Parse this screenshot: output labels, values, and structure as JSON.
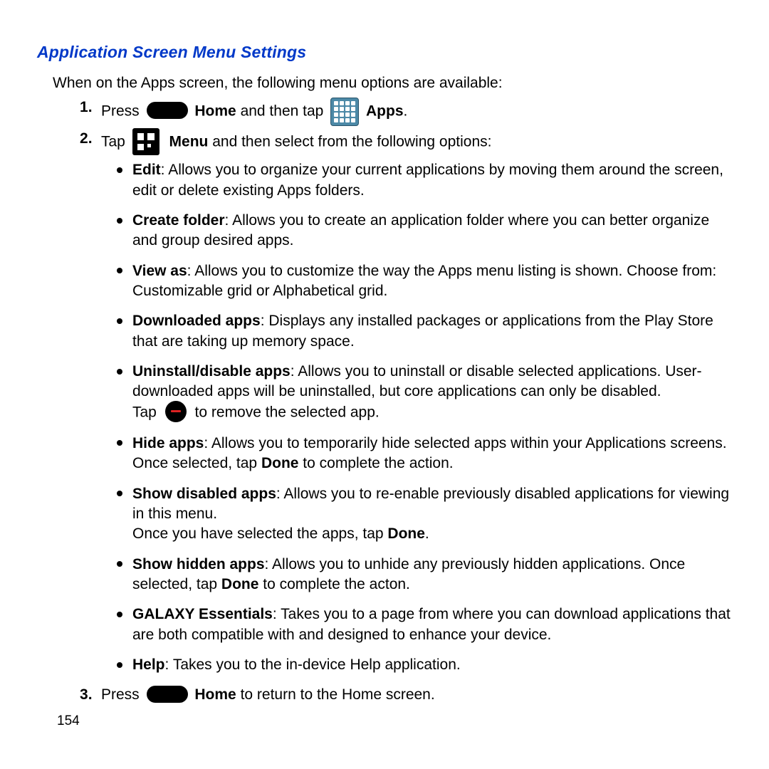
{
  "title": "Application Screen Menu Settings",
  "intro": "When on the Apps screen, the following menu options are available:",
  "step1": {
    "press": "Press ",
    "home": "Home",
    "and_tap": " and then tap ",
    "apps": "Apps",
    "period": "."
  },
  "step2": {
    "tap": "Tap ",
    "menu": "Menu",
    "rest": " and then select from the following options:"
  },
  "options": [
    {
      "name": "Edit",
      "colon": ": ",
      "desc": "Allows you to organize your current applications by moving them around the screen, edit or delete existing Apps folders."
    },
    {
      "name": "Create folder",
      "colon": ": ",
      "desc": "Allows you to create an application folder where you can better organize and group desired apps."
    },
    {
      "name": "View as",
      "colon": ": ",
      "desc": "Allows you to customize the way the Apps menu listing is shown. Choose from: Customizable grid or Alphabetical grid."
    },
    {
      "name": "Downloaded apps",
      "colon": ": ",
      "desc": "Displays any installed packages or applications from the Play Store that are taking up memory space."
    },
    {
      "name": "Uninstall/disable apps",
      "colon": ": ",
      "desc": "Allows you to uninstall or disable selected applications. User-downloaded apps will be uninstalled, but core applications can only be disabled."
    }
  ],
  "remove_line": {
    "pre": "Tap ",
    "post": " to remove the selected app."
  },
  "options2": [
    {
      "name": "Hide apps",
      "colon": ": ",
      "pre": "Allows you to temporarily hide selected apps within your Applications screens. Once selected, tap ",
      "bold": "Done",
      "post": " to complete the action."
    },
    {
      "name": "Show disabled apps",
      "colon": ": ",
      "desc": "Allows you to re-enable previously disabled applications for viewing in this menu.",
      "line2_pre": "Once you have selected the apps, tap ",
      "line2_bold": "Done",
      "line2_post": "."
    },
    {
      "name": "Show hidden apps",
      "colon": ": ",
      "pre": "Allows you to unhide any previously hidden applications. Once selected, tap ",
      "bold": "Done",
      "post": " to complete the acton."
    },
    {
      "name": "GALAXY Essentials",
      "colon": ": ",
      "desc": "Takes you to a page from where you can download applications that are both compatible with and designed to enhance your device."
    },
    {
      "name": "Help",
      "colon": ": ",
      "desc": "Takes you to the in-device Help application."
    }
  ],
  "step3": {
    "press": "Press ",
    "home": "Home",
    "rest": " to return to the Home screen."
  },
  "page_number": "154"
}
